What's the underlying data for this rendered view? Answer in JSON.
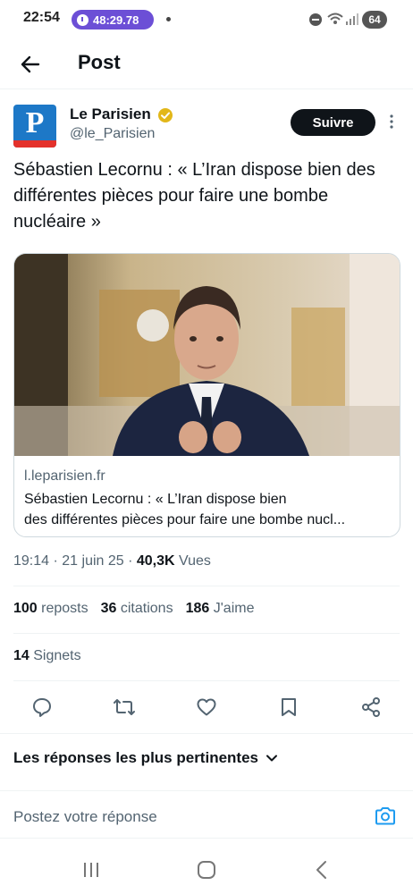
{
  "status_bar": {
    "time": "22:54",
    "timer": "48:29.78",
    "battery": "64",
    "timer_color": "#6c4fd6"
  },
  "header": {
    "title": "Post",
    "back_icon": "arrow-left-icon"
  },
  "author": {
    "name": "Le Parisien",
    "handle": "@le_Parisien",
    "follow_label": "Suivre",
    "verified_color": "#e2b719",
    "avatar_bg": "#1d78c7"
  },
  "tweet": {
    "text": "Sébastien Lecornu : « L’Iran dispose bien des différentes pièces pour faire une bombe nucléaire »"
  },
  "link_card": {
    "domain": "l.leparisien.fr",
    "title_line1": "Sébastien Lecornu : « L’Iran dispose bien",
    "title_line2": "des différentes pièces pour faire une bombe nucl..."
  },
  "meta": {
    "time": "19:14",
    "sep1": " · ",
    "date": "21 juin 25",
    "sep2": " · ",
    "views_count": "40,3K",
    "views_label": " Vues"
  },
  "stats": {
    "reposts_count": "100",
    "reposts_label": "reposts",
    "quotes_count": "36",
    "quotes_label": "citations",
    "likes_count": "186",
    "likes_label": "J'aime",
    "bookmarks_count": "14",
    "bookmarks_label": "Signets"
  },
  "actions": [
    "reply-icon",
    "repost-icon",
    "like-icon",
    "bookmark-icon",
    "share-icon"
  ],
  "replies": {
    "sort_label": "Les réponses les plus pertinentes"
  },
  "composer": {
    "placeholder": "Postez votre réponse",
    "accent": "#1d9bf0"
  },
  "navbar": [
    "recent-apps-icon",
    "home-icon",
    "back-icon"
  ]
}
